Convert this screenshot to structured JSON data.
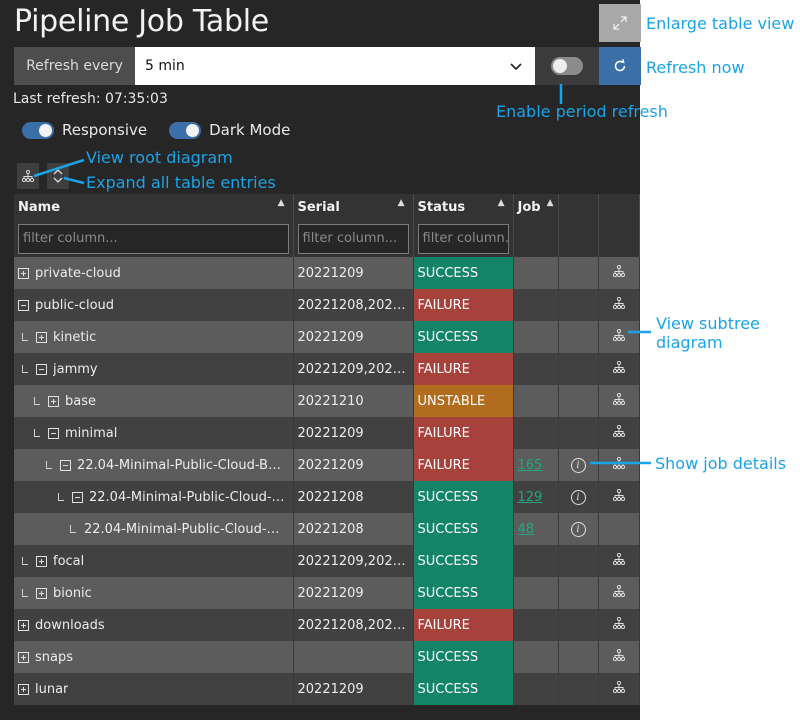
{
  "title": "Pipeline Job Table",
  "refresh": {
    "label": "Refresh every",
    "interval": "5 min",
    "last_refresh": "Last refresh: 07:35:03"
  },
  "switches": [
    {
      "label": "Responsive",
      "on": true
    },
    {
      "label": "Dark Mode",
      "on": true
    }
  ],
  "columns": {
    "name": "Name",
    "serial": "Serial",
    "status": "Status",
    "job": "Job",
    "filter_placeholder": "filter column..."
  },
  "rows": [
    {
      "name": "private-cloud",
      "depth": 0,
      "expander": "plus",
      "serial": "20221209",
      "status": "SUCCESS",
      "job": "",
      "info": false,
      "tree": true
    },
    {
      "name": "public-cloud",
      "depth": 0,
      "expander": "minus",
      "serial": "20221208,2022...",
      "status": "FAILURE",
      "job": "",
      "info": false,
      "tree": true
    },
    {
      "name": "kinetic",
      "depth": 1,
      "expander": "plus",
      "serial": "20221209",
      "status": "SUCCESS",
      "job": "",
      "info": false,
      "tree": true
    },
    {
      "name": "jammy",
      "depth": 1,
      "expander": "minus",
      "serial": "20221209,2022...",
      "status": "FAILURE",
      "job": "",
      "info": false,
      "tree": true
    },
    {
      "name": "base",
      "depth": 2,
      "expander": "plus",
      "serial": "20221210",
      "status": "UNSTABLE",
      "job": "",
      "info": false,
      "tree": true
    },
    {
      "name": "minimal",
      "depth": 2,
      "expander": "minus",
      "serial": "20221209",
      "status": "FAILURE",
      "job": "",
      "info": false,
      "tree": true
    },
    {
      "name": "22.04-Minimal-Public-Cloud-Buil...",
      "depth": 3,
      "expander": "minus",
      "serial": "20221209",
      "status": "FAILURE",
      "job": "165",
      "info": true,
      "tree": true
    },
    {
      "name": "22.04-Minimal-Public-Cloud-S...",
      "depth": 4,
      "expander": "minus",
      "serial": "20221208",
      "status": "SUCCESS",
      "job": "129",
      "info": true,
      "tree": true
    },
    {
      "name": "22.04-Minimal-Public-Cloud-D...",
      "depth": 5,
      "expander": "none",
      "serial": "20221208",
      "status": "SUCCESS",
      "job": "48",
      "info": true,
      "tree": false
    },
    {
      "name": "focal",
      "depth": 1,
      "expander": "plus",
      "serial": "20221209,2022...",
      "status": "SUCCESS",
      "job": "",
      "info": false,
      "tree": true
    },
    {
      "name": "bionic",
      "depth": 1,
      "expander": "plus",
      "serial": "20221209",
      "status": "SUCCESS",
      "job": "",
      "info": false,
      "tree": true
    },
    {
      "name": "downloads",
      "depth": 0,
      "expander": "plus",
      "serial": "20221208,2022...",
      "status": "FAILURE",
      "job": "",
      "info": false,
      "tree": true
    },
    {
      "name": "snaps",
      "depth": 0,
      "expander": "plus",
      "serial": "",
      "status": "SUCCESS",
      "job": "",
      "info": false,
      "tree": true
    },
    {
      "name": "lunar",
      "depth": 0,
      "expander": "plus",
      "serial": "20221209",
      "status": "SUCCESS",
      "job": "",
      "info": false,
      "tree": true
    }
  ],
  "annotations": {
    "enlarge": "Enlarge table view",
    "refresh_now": "Refresh now",
    "period": "Enable period refresh",
    "root": "View root diagram",
    "expand": "Expand all table entries",
    "subtree": "View subtree\ndiagram",
    "details": "Show job details"
  },
  "colors": {
    "success": "#138467",
    "failure": "#a7413b",
    "unstable": "#b26c1d",
    "annotation": "#1aa3e6",
    "accent_button": "#3b6fa8"
  }
}
